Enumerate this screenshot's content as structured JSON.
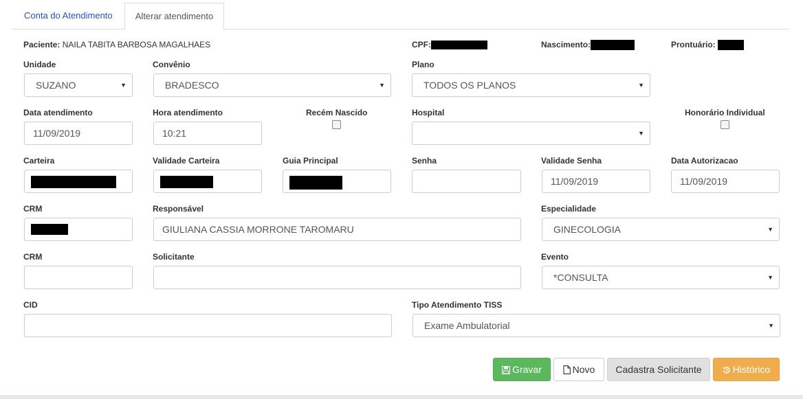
{
  "tabs": [
    "Conta do Atendimento",
    "Alterar atendimento"
  ],
  "header": {
    "paciente_label": "Paciente:",
    "paciente_value": "NAILA TABITA BARBOSA MAGALHAES",
    "cpf_label": "CPF:",
    "nascimento_label": "Nascimento:",
    "prontuario_label": "Prontuário:"
  },
  "form": {
    "unidade": {
      "label": "Unidade",
      "value": "SUZANO"
    },
    "convenio": {
      "label": "Convênio",
      "value": "BRADESCO"
    },
    "plano": {
      "label": "Plano",
      "value": "TODOS OS PLANOS"
    },
    "data_atendimento": {
      "label": "Data atendimento",
      "value": "11/09/2019"
    },
    "hora_atendimento": {
      "label": "Hora atendimento",
      "value": "10:21"
    },
    "recem_nascido": {
      "label": "Recém Nascido"
    },
    "hospital": {
      "label": "Hospital",
      "value": ""
    },
    "honorario_individual": {
      "label": "Honorário Individual"
    },
    "carteira": {
      "label": "Carteira"
    },
    "validade_carteira": {
      "label": "Validade Carteira"
    },
    "guia_principal": {
      "label": "Guia Principal"
    },
    "senha": {
      "label": "Senha",
      "value": ""
    },
    "validade_senha": {
      "label": "Validade Senha",
      "value": "11/09/2019"
    },
    "data_autorizacao": {
      "label": "Data Autorizacao",
      "value": "11/09/2019"
    },
    "crm_responsavel": {
      "label": "CRM"
    },
    "responsavel": {
      "label": "Responsável",
      "value": "GIULIANA CASSIA MORRONE TAROMARU"
    },
    "especialidade": {
      "label": "Especialidade",
      "value": "GINECOLOGIA"
    },
    "crm_solicitante": {
      "label": "CRM",
      "value": ""
    },
    "solicitante": {
      "label": "Solicitante",
      "value": ""
    },
    "evento": {
      "label": "Evento",
      "value": "*CONSULTA"
    },
    "cid": {
      "label": "CID",
      "value": ""
    },
    "tipo_atendimento": {
      "label": "Tipo Atendimento TISS",
      "value": "Exame Ambulatorial"
    }
  },
  "buttons": {
    "gravar": "Gravar",
    "novo": "Novo",
    "cadastra_solicitante": "Cadastra Solicitante",
    "historico": "Histórico"
  },
  "colors": {
    "gravar": "#5cb85c",
    "historico": "#f0ad4e",
    "tab_link": "#2a4ed0"
  }
}
